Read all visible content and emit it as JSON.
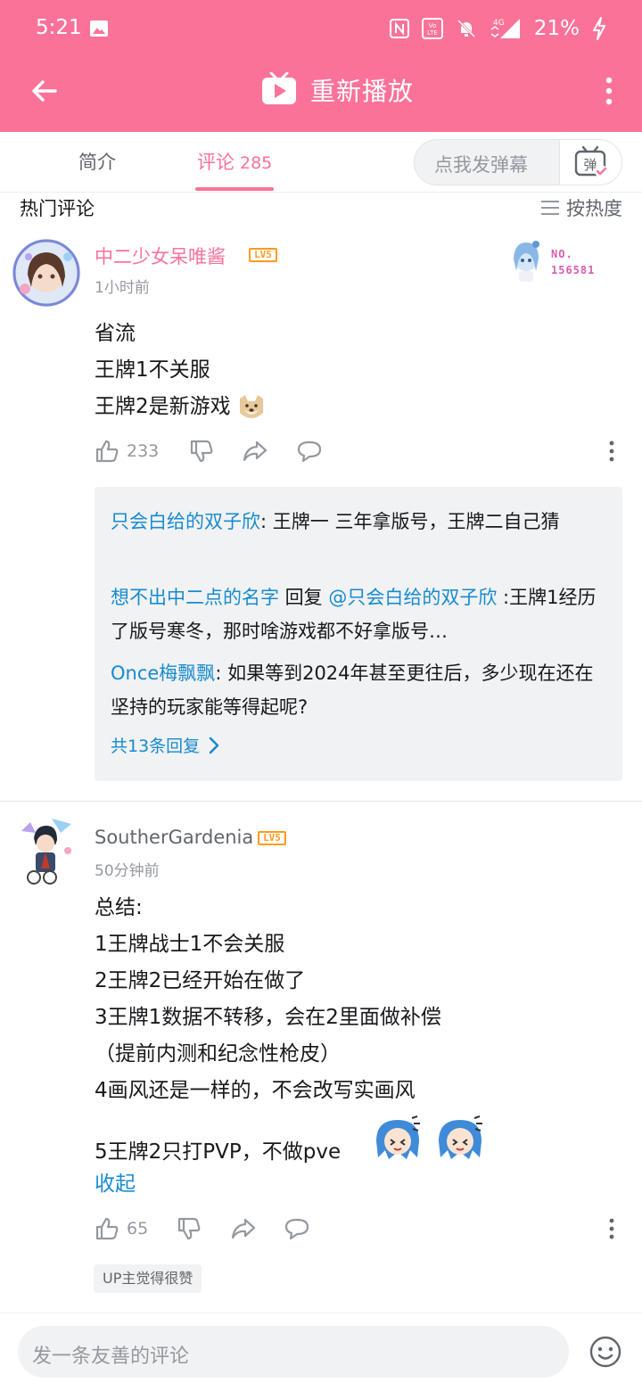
{
  "status_bar": {
    "time": "5:21",
    "battery": "21%",
    "network": "4G"
  },
  "header": {
    "title": "重新播放"
  },
  "tabs": {
    "intro": "简介",
    "comments": "评论",
    "comment_count": "285",
    "danmaku_placeholder": "点我发弹幕",
    "danmaku_button": "弹"
  },
  "hot": {
    "title": "热门评论",
    "sort_label": "按热度"
  },
  "comments": [
    {
      "user": "中二少女呆唯酱",
      "level": "LV5",
      "time": "1小时前",
      "badge_no_label": "NO.",
      "badge_no": "156581",
      "lines": [
        "省流",
        "王牌1不关服",
        "王牌2是新游戏"
      ],
      "likes": "233",
      "replies": [
        {
          "user": "只会白给的双子欣",
          "sep": ": ",
          "text": "王牌一 三年拿版号，王牌二自己猜"
        },
        {
          "user": "想不出中二点的名字",
          "mid": " 回复 ",
          "target": "@只会白给的双子欣",
          "text": " :王牌1经历了版号寒冬，那时啥游戏都不好拿版号…"
        },
        {
          "user": "Once梅飘飘",
          "sep": ": ",
          "text": "如果等到2024年甚至更往后，多少现在还在坚持的玩家能等得起呢?"
        }
      ],
      "more_replies": "共13条回复"
    },
    {
      "user": "SoutherGardenia",
      "level": "LV5",
      "time": "50分钟前",
      "lines": [
        "总结:",
        "1王牌战士1不会关服",
        "2王牌2已经开始在做了",
        "3王牌1数据不转移，会在2里面做补偿",
        "（提前内测和纪念性枪皮）",
        "4画风还是一样的，不会改写实画风",
        "",
        "5王牌2只打PVP，不做pve"
      ],
      "collapse": "收起",
      "likes": "65",
      "up_badge": "UP主觉得很赞"
    }
  ],
  "bottom": {
    "placeholder": "发一条友善的评论"
  },
  "colors": {
    "brand_pink": "#fb7299",
    "link_blue": "#178bcf",
    "level_orange": "#ff9b1f"
  }
}
